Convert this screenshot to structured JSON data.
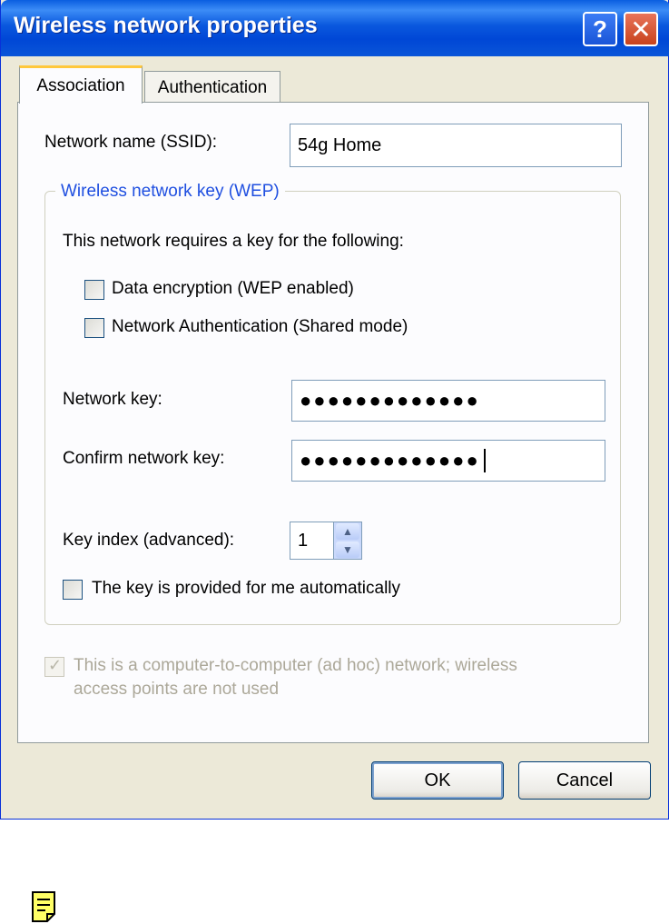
{
  "window": {
    "title": "Wireless network properties",
    "help_glyph": "?",
    "close_glyph": "✕"
  },
  "tabs": [
    {
      "label": "Association",
      "selected": true
    },
    {
      "label": "Authentication",
      "selected": false
    }
  ],
  "association": {
    "ssid_label": "Network name (SSID):",
    "ssid_value": "54g Home",
    "group_title": "Wireless network key (WEP)",
    "requires_text": "This network requires a key for the following:",
    "data_encryption_label": "Data encryption (WEP enabled)",
    "data_encryption_checked": false,
    "shared_auth_label": "Network Authentication (Shared mode)",
    "shared_auth_checked": false,
    "network_key_label": "Network key:",
    "network_key_mask": "●●●●●●●●●●●●●",
    "confirm_key_label": "Confirm network key:",
    "confirm_key_mask": "●●●●●●●●●●●●●",
    "key_index_label": "Key index (advanced):",
    "key_index_value": "1",
    "auto_key_label": "The key is provided for me automatically",
    "auto_key_checked": false,
    "adhoc_line1": "This is a computer-to-computer (ad hoc) network; wireless",
    "adhoc_line2": "access points are not used",
    "adhoc_checked": true,
    "adhoc_disabled": true
  },
  "buttons": {
    "ok": "OK",
    "cancel": "Cancel"
  },
  "footer_icon": "note-icon",
  "colors": {
    "title_bar": "#0a58de",
    "group_title": "#1f4fe0",
    "dialog_face": "#ece9d8"
  }
}
